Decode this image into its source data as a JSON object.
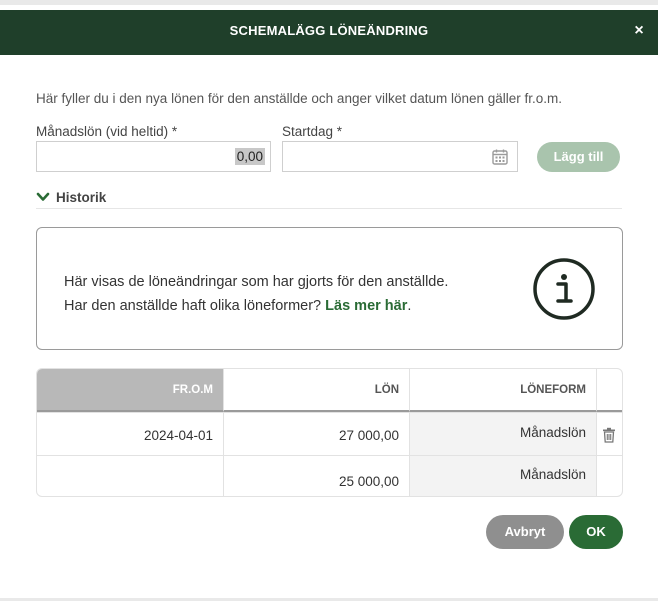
{
  "dialog": {
    "title": "SCHEMALÄGG LÖNEÄNDRING",
    "close_icon": "close-icon",
    "intro": "Här fyller du i den nya lönen för den anställde och anger vilket datum lönen gäller fr.o.m."
  },
  "form": {
    "salary_label": "Månadslön (vid heltid) *",
    "salary_value": "0,00",
    "start_label": "Startdag *",
    "start_value": "",
    "calendar_icon": "calendar-icon",
    "add_label": "Lägg till"
  },
  "history": {
    "label": "Historik",
    "icon": "chevron-down-icon"
  },
  "info": {
    "line1": "Här visas de löneändringar som har gjorts för den anställde.",
    "line2_prefix": "Har den anställde haft olika löneformer? ",
    "link": "Läs mer här",
    "line2_suffix": ".",
    "icon": "info-icon"
  },
  "table": {
    "headers": [
      "FR.O.M",
      "LÖN",
      "LÖNEFORM"
    ],
    "rows": [
      {
        "from": "2024-04-01",
        "salary": "27 000,00",
        "form": "Månadslön",
        "action_icon": "trash-icon"
      },
      {
        "from": "",
        "salary": "25 000,00",
        "form": "Månadslön"
      }
    ]
  },
  "actions": {
    "cancel": "Avbryt",
    "ok": "OK"
  },
  "colors": {
    "header_bg": "#1f3f2a",
    "primary": "#2a6b35",
    "add_button_disabled": "#a9c4ad",
    "cancel": "#8f8f8f"
  }
}
